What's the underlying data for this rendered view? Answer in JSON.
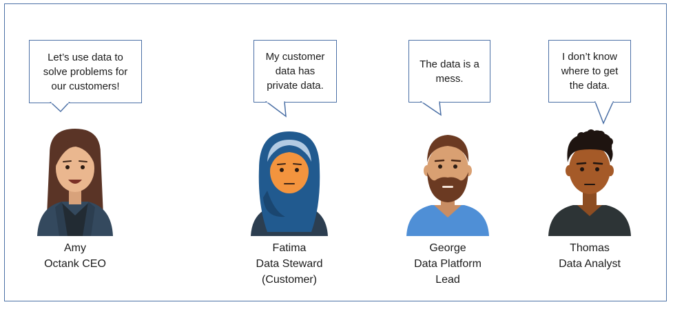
{
  "colors": {
    "frame": "#4a6fa5",
    "bubble_border": "#4a6fa5"
  },
  "personas": [
    {
      "speech": "Let’s use data to\nsolve problems for\nour customers!",
      "name": "Amy",
      "role_lines": [
        "Octank CEO"
      ],
      "avatar": "woman-long-hair-avatar-icon"
    },
    {
      "speech": "My customer\ndata has\nprivate data.",
      "name": "Fatima",
      "role_lines": [
        "Data Steward",
        "(Customer)"
      ],
      "avatar": "woman-hijab-avatar-icon"
    },
    {
      "speech": "The data is a\nmess.",
      "name": "George",
      "role_lines": [
        "Data Platform",
        "Lead"
      ],
      "avatar": "man-beard-avatar-icon"
    },
    {
      "speech": "I don’t know\nwhere to get\nthe data.",
      "name": "Thomas",
      "role_lines": [
        "Data Analyst"
      ],
      "avatar": "man-curly-hair-avatar-icon"
    }
  ]
}
